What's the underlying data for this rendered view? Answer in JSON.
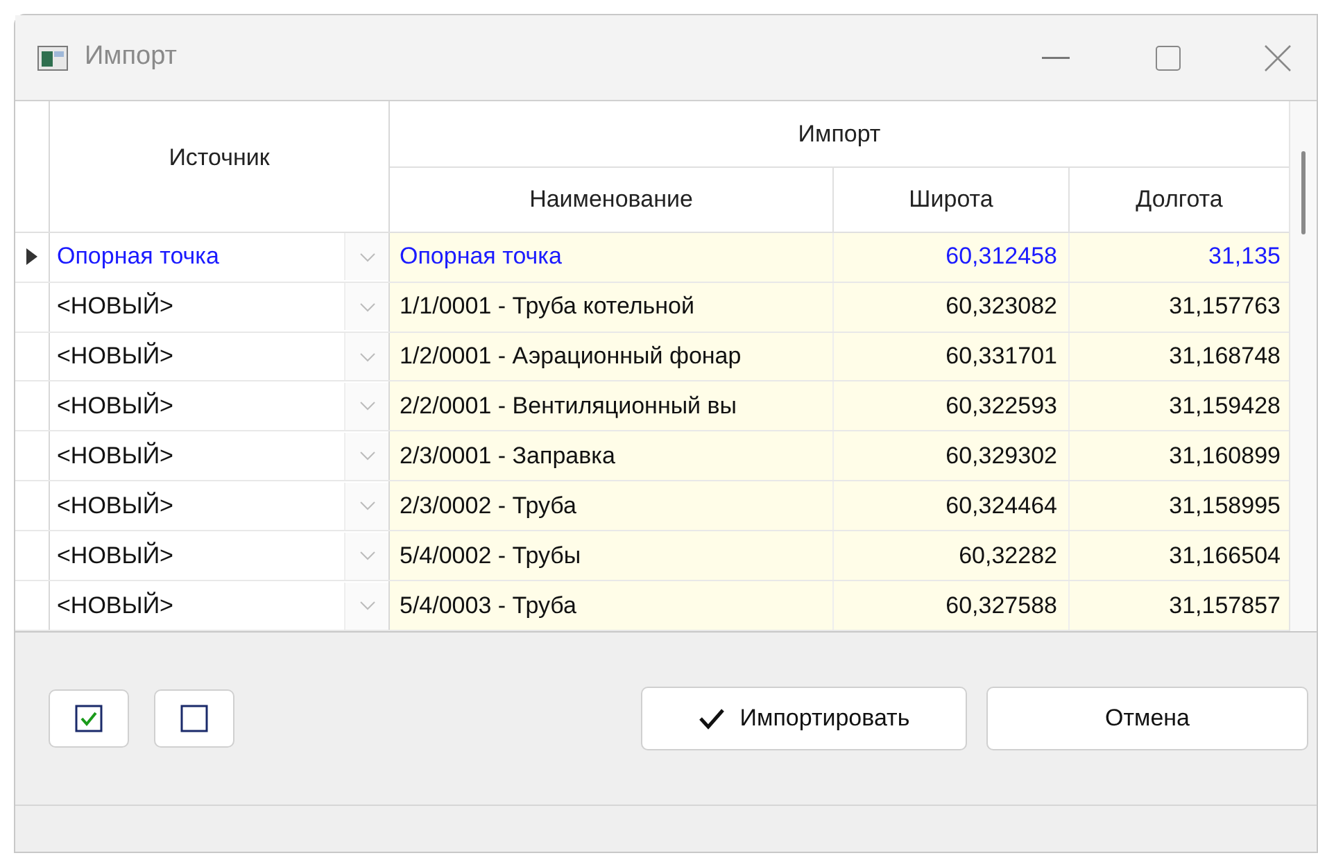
{
  "window": {
    "title": "Импорт"
  },
  "table": {
    "group_header": "Импорт",
    "columns": [
      "Источник",
      "Наименование",
      "Широта",
      "Долгота"
    ],
    "rows": [
      {
        "source": "Опорная точка",
        "name": "Опорная точка",
        "lat": "60,312458",
        "lon": "31,135",
        "selected": true
      },
      {
        "source": "<НОВЫЙ>",
        "name": "1/1/0001 - Труба котельной",
        "lat": "60,323082",
        "lon": "31,157763",
        "selected": false
      },
      {
        "source": "<НОВЫЙ>",
        "name": "1/2/0001 - Аэрационный фонар",
        "lat": "60,331701",
        "lon": "31,168748",
        "selected": false
      },
      {
        "source": "<НОВЫЙ>",
        "name": "2/2/0001 - Вентиляционный вы",
        "lat": "60,322593",
        "lon": "31,159428",
        "selected": false
      },
      {
        "source": "<НОВЫЙ>",
        "name": "2/3/0001 - Заправка",
        "lat": "60,329302",
        "lon": "31,160899",
        "selected": false
      },
      {
        "source": "<НОВЫЙ>",
        "name": "2/3/0002 - Труба",
        "lat": "60,324464",
        "lon": "31,158995",
        "selected": false
      },
      {
        "source": "<НОВЫЙ>",
        "name": "5/4/0002 - Трубы",
        "lat": "60,32282",
        "lon": "31,166504",
        "selected": false
      },
      {
        "source": "<НОВЫЙ>",
        "name": "5/4/0003 - Труба",
        "lat": "60,327588",
        "lon": "31,157857",
        "selected": false
      }
    ]
  },
  "buttons": {
    "import": "Импортировать",
    "cancel": "Отмена"
  }
}
